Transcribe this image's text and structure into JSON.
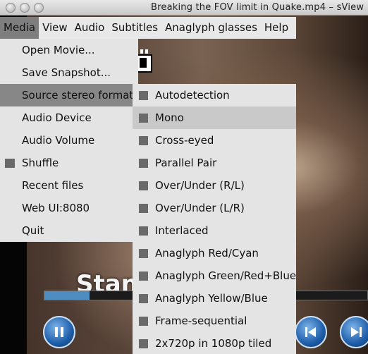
{
  "window": {
    "title": "Breaking the FOV limit in Quake.mp4 – sView"
  },
  "menubar": {
    "items": [
      {
        "label": "Media",
        "active": true
      },
      {
        "label": "View",
        "active": false
      },
      {
        "label": "Audio",
        "active": false
      },
      {
        "label": "Subtitles",
        "active": false
      },
      {
        "label": "Anaglyph glasses",
        "active": false
      },
      {
        "label": "Help",
        "active": false
      }
    ]
  },
  "media_menu": {
    "items": [
      {
        "label": "Open Movie...",
        "checked": false,
        "active": false
      },
      {
        "label": "Save Snapshot...",
        "checked": false,
        "active": false
      },
      {
        "label": "Source stereo format",
        "checked": false,
        "active": true
      },
      {
        "label": "Audio Device",
        "checked": false,
        "active": false
      },
      {
        "label": "Audio Volume",
        "checked": false,
        "active": false
      },
      {
        "label": "Shuffle",
        "checked": true,
        "active": false
      },
      {
        "label": "Recent files",
        "checked": false,
        "active": false
      },
      {
        "label": "Web UI:8080",
        "checked": false,
        "active": false
      },
      {
        "label": "Quit",
        "checked": false,
        "active": false
      }
    ]
  },
  "stereo_submenu": {
    "items": [
      {
        "label": "Autodetection",
        "active": false
      },
      {
        "label": "Mono",
        "active": true
      },
      {
        "label": "Cross-eyed",
        "active": false
      },
      {
        "label": "Parallel Pair",
        "active": false
      },
      {
        "label": "Over/Under (R/L)",
        "active": false
      },
      {
        "label": "Over/Under (L/R)",
        "active": false
      },
      {
        "label": "Interlaced",
        "active": false
      },
      {
        "label": "Anaglyph Red/Cyan",
        "active": false
      },
      {
        "label": "Anaglyph Green/Red+Blue",
        "active": false
      },
      {
        "label": "Anaglyph Yellow/Blue",
        "active": false
      },
      {
        "label": "Frame-sequential",
        "active": false
      },
      {
        "label": "2x720p in 1080p tiled",
        "active": false
      }
    ]
  },
  "video": {
    "overlay_text": "Stan",
    "progress": 0.14
  },
  "colors": {
    "menu_bg": "#e4e4e4",
    "active_item": "#878787",
    "accent_blue": "#1e5da8"
  }
}
